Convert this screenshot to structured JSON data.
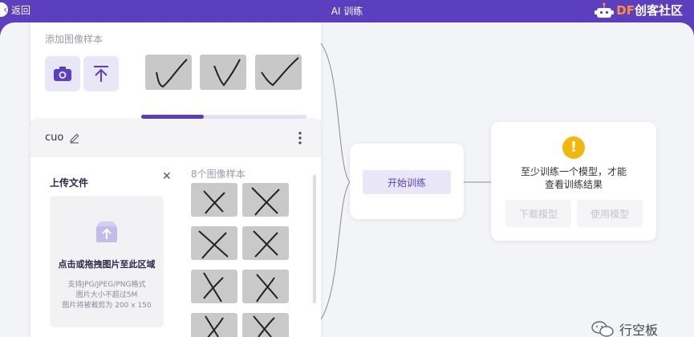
{
  "topbar": {
    "back_label": "返回",
    "title": "AI 训练",
    "brand_prefix": "DF",
    "brand_suffix": "创客社区"
  },
  "class_card_1": {
    "add_samples_hint": "添加图像样本",
    "buttons": [
      "webcam",
      "upload"
    ],
    "thumbnail_count": 3,
    "progress_fraction": 0.38
  },
  "class_card_2": {
    "class_name": "cuo",
    "upload_panel": {
      "title": "上传文件",
      "dropzone_main": "点击或拖拽图片至此区域",
      "dropzone_line1": "支持JPG/JPEG/PNG格式",
      "dropzone_line2": "图片大小不超过5M",
      "dropzone_line3": "图片将被裁剪为 200 x 150"
    },
    "sample_count_label": "8个图像样本"
  },
  "training": {
    "start_button": "开始训练"
  },
  "preview": {
    "warning_text_line1": "至少训练一个模型，才能",
    "warning_text_line2": "查看训练结果",
    "download_button": "下载模型",
    "use_button": "使用模型"
  },
  "watermark": {
    "text": "行空板"
  },
  "colors": {
    "accent": "#5b3fbf",
    "accent_light": "#e9e6f7",
    "warning": "#f2b70d",
    "canvas_bg": "#f3f4f8"
  }
}
